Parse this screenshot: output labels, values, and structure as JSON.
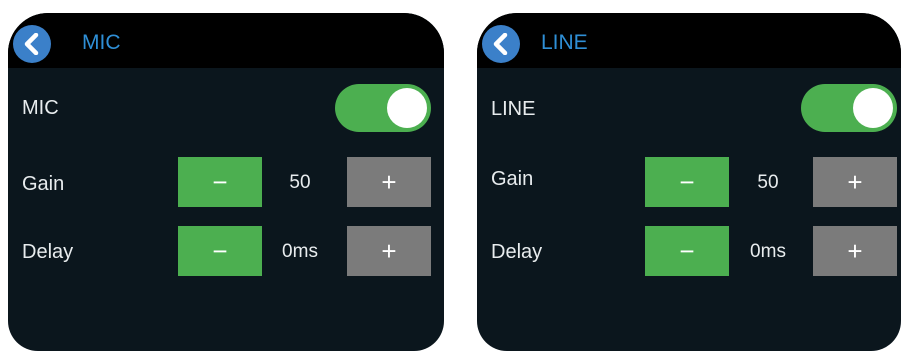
{
  "panels": [
    {
      "title": "MIC",
      "enable_label": "MIC",
      "enabled": true,
      "gain_label": "Gain",
      "gain_value": "50",
      "delay_label": "Delay",
      "delay_value": "0ms",
      "minus_symbol": "−",
      "plus_symbol": "+"
    },
    {
      "title": "LINE",
      "enable_label": "LINE",
      "enabled": true,
      "gain_label": "Gain",
      "gain_value": "50",
      "delay_label": "Delay",
      "delay_value": "0ms",
      "minus_symbol": "−",
      "plus_symbol": "+"
    }
  ],
  "colors": {
    "background": "#0b161d",
    "titlebar": "#000000",
    "accent_blue": "#2f8fd6",
    "toggle_on": "#4caf50",
    "minus_button": "#4caf50",
    "plus_button": "#7b7b7b"
  },
  "icons": {
    "back": "chevron-left-icon"
  }
}
